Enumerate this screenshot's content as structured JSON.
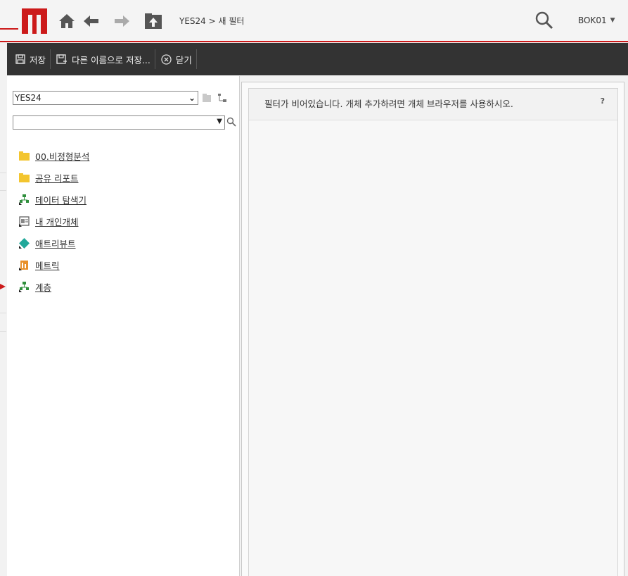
{
  "header": {
    "breadcrumb": {
      "root": "YES24",
      "separator": " > ",
      "current": "새 필터"
    },
    "user": "BOK01",
    "icons": [
      "home-icon",
      "back-arrow-icon",
      "forward-arrow-icon",
      "folder-up-icon",
      "search-icon"
    ],
    "brand_color": "#cc1a1a"
  },
  "toolbar": {
    "save_label": "저장",
    "save_as_label": "다른 이름으로 저장...",
    "close_label": "닫기"
  },
  "left_panel": {
    "project_select": "YES24",
    "search_value": "",
    "tree": [
      {
        "label": "00.비정형분석",
        "icon": "folder-icon"
      },
      {
        "label": "공유 리포트",
        "icon": "folder-icon"
      },
      {
        "label": "데이터 탐색기",
        "icon": "hierarchy-shortcut-icon"
      },
      {
        "label": "내 개인개체",
        "icon": "personal-objects-icon"
      },
      {
        "label": "애트리뷰트",
        "icon": "attribute-icon"
      },
      {
        "label": "메트릭",
        "icon": "metric-icon"
      },
      {
        "label": "계층",
        "icon": "hierarchy-icon"
      }
    ]
  },
  "right_panel": {
    "empty_message": "필터가 비어있습니다. 개체 추가하려면 개체 브라우저를 사용하시오.",
    "help_label": "?"
  }
}
